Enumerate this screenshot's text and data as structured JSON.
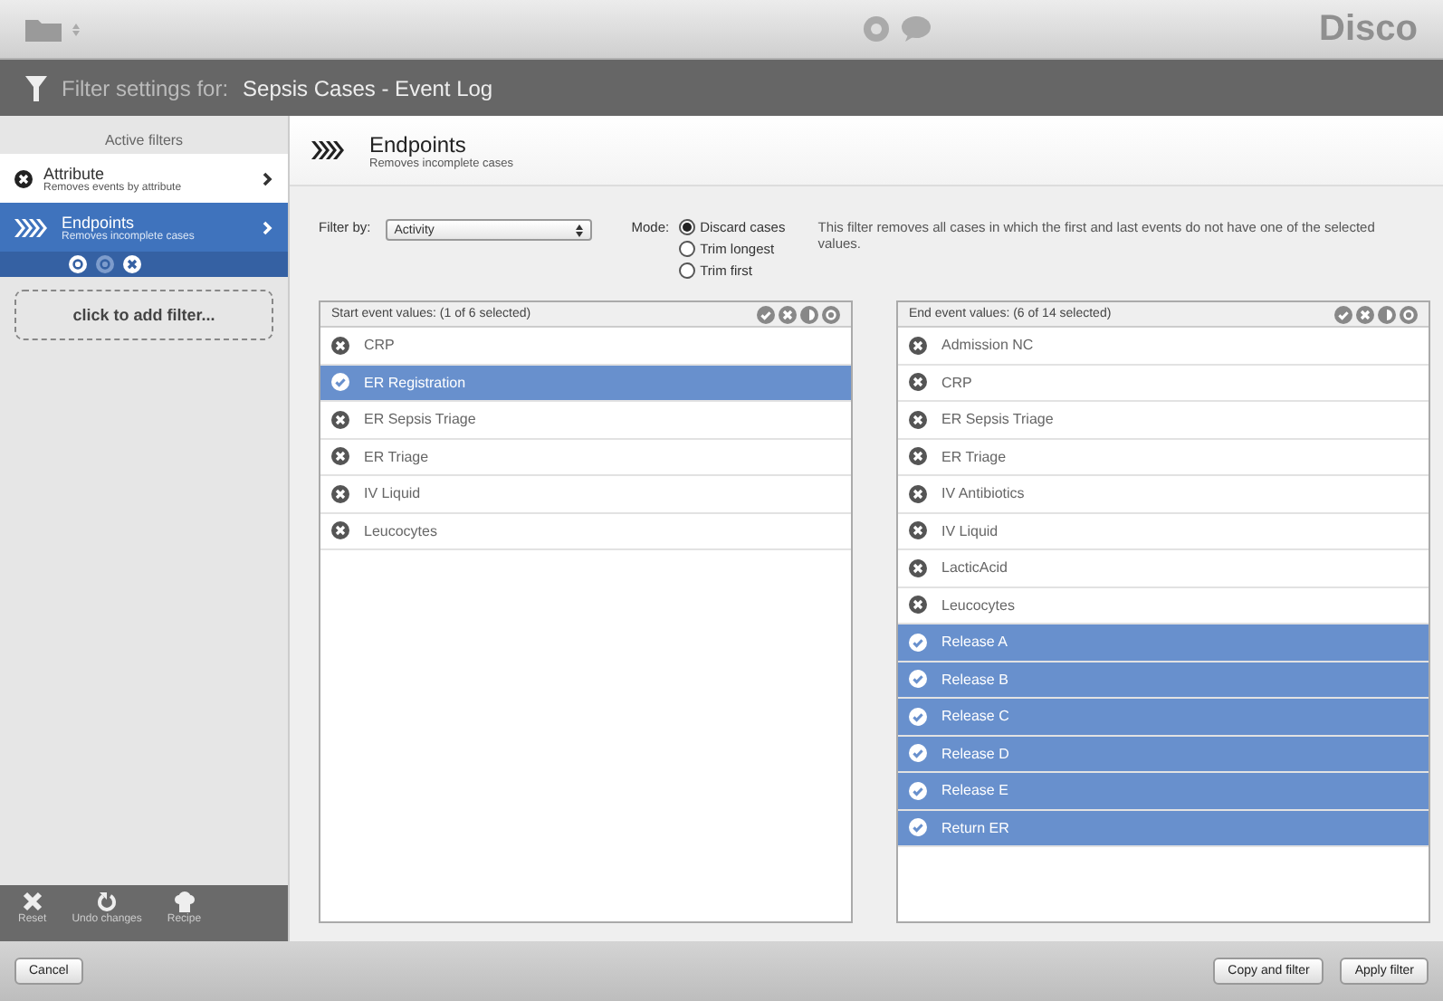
{
  "top_bar": {
    "brand": "Disco"
  },
  "header": {
    "label": "Filter settings for:",
    "log_name": "Sepsis Cases - Event Log"
  },
  "sidebar": {
    "title": "Active filters",
    "filters": [
      {
        "name": "Attribute",
        "description": "Removes events by attribute",
        "kind": "attribute",
        "selected": false
      },
      {
        "name": "Endpoints",
        "description": "Removes incomplete cases",
        "kind": "endpoints",
        "selected": true
      }
    ],
    "add_filter": "click to add filter...",
    "tools": [
      {
        "kind": "reset",
        "label": "Reset"
      },
      {
        "kind": "undo",
        "label": "Undo changes"
      },
      {
        "kind": "recipe",
        "label": "Recipe"
      }
    ]
  },
  "filter": {
    "title": "Endpoints",
    "subtitle": "Removes incomplete cases",
    "filter_by_label": "Filter by:",
    "filter_by_value": "Activity",
    "mode_label": "Mode:",
    "modes": [
      {
        "label": "Discard cases",
        "selected": true
      },
      {
        "label": "Trim longest",
        "selected": false
      },
      {
        "label": "Trim first",
        "selected": false
      }
    ],
    "description": "This filter removes all cases in which the first and last events do not have one of the selected values."
  },
  "lists": [
    {
      "title": "Start event values:  (1 of 6 selected)",
      "items": [
        {
          "label": "CRP",
          "selected": false
        },
        {
          "label": "ER Registration",
          "selected": true
        },
        {
          "label": "ER Sepsis Triage",
          "selected": false
        },
        {
          "label": "ER Triage",
          "selected": false
        },
        {
          "label": "IV Liquid",
          "selected": false
        },
        {
          "label": "Leucocytes",
          "selected": false
        }
      ]
    },
    {
      "title": "End event values:  (6 of 14 selected)",
      "items": [
        {
          "label": "Admission NC",
          "selected": false
        },
        {
          "label": "CRP",
          "selected": false
        },
        {
          "label": "ER Sepsis Triage",
          "selected": false
        },
        {
          "label": "ER Triage",
          "selected": false
        },
        {
          "label": "IV Antibiotics",
          "selected": false
        },
        {
          "label": "IV Liquid",
          "selected": false
        },
        {
          "label": "LacticAcid",
          "selected": false
        },
        {
          "label": "Leucocytes",
          "selected": false
        },
        {
          "label": "Release A",
          "selected": true
        },
        {
          "label": "Release B",
          "selected": true
        },
        {
          "label": "Release C",
          "selected": true
        },
        {
          "label": "Release D",
          "selected": true
        },
        {
          "label": "Release E",
          "selected": true
        },
        {
          "label": "Return ER",
          "selected": true
        }
      ]
    }
  ],
  "footer": {
    "cancel": "Cancel",
    "buttons": [
      "Copy and filter",
      "Apply filter"
    ]
  }
}
